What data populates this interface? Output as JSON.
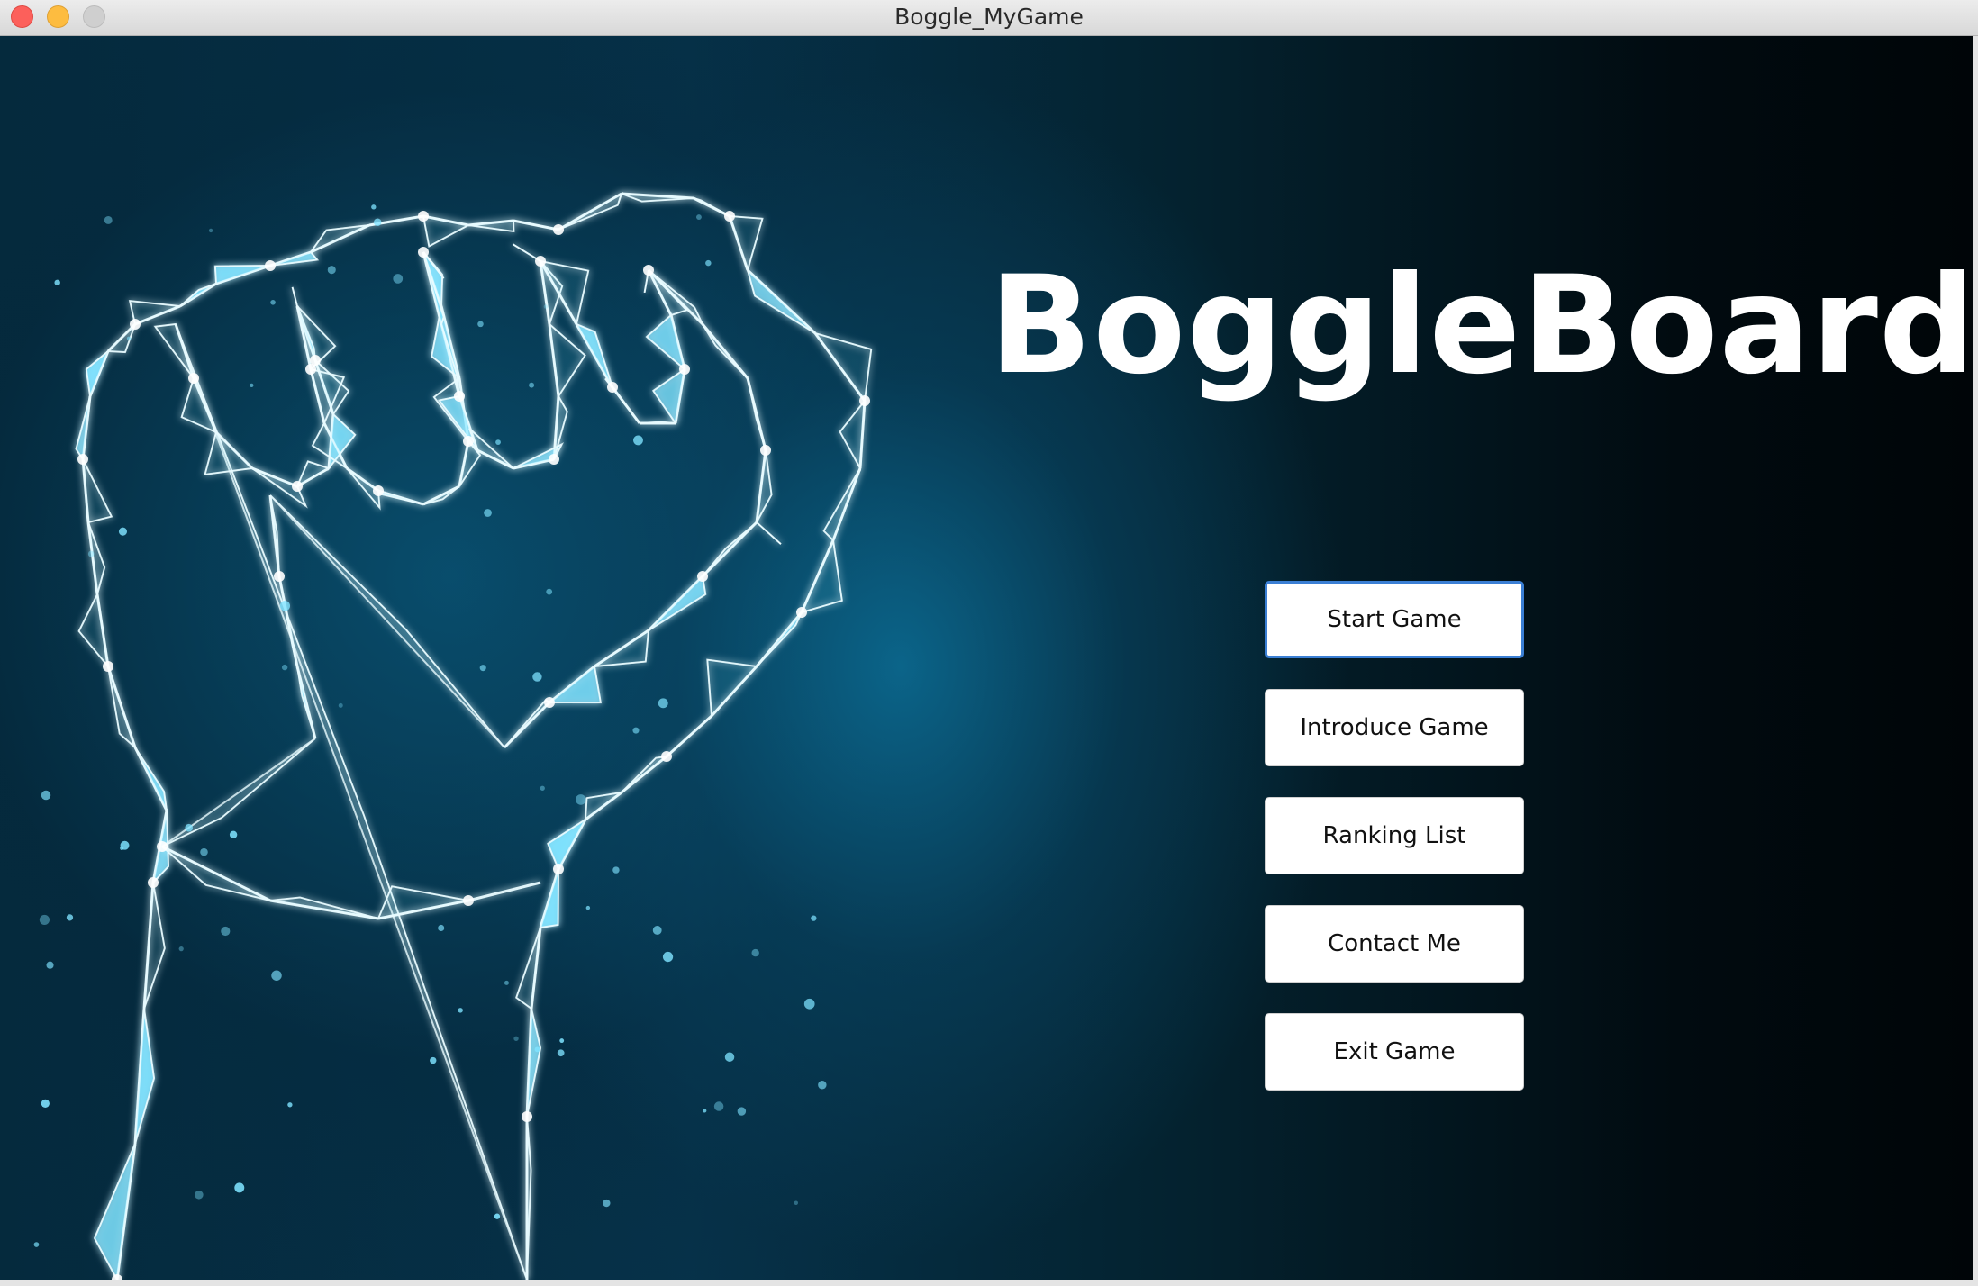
{
  "window": {
    "title": "Boggle_MyGame"
  },
  "main": {
    "game_title": "BoggleBoard",
    "buttons": [
      {
        "label": "Start Game",
        "focused": true
      },
      {
        "label": "Introduce Game"
      },
      {
        "label": "Ranking List"
      },
      {
        "label": "Contact Me"
      },
      {
        "label": "Exit Game"
      }
    ]
  },
  "background": {
    "image": "polygonal-glowing-raised-fist",
    "colors": {
      "dark": "#000508",
      "mid": "#06324a",
      "glow": "#7fe3ff"
    }
  }
}
